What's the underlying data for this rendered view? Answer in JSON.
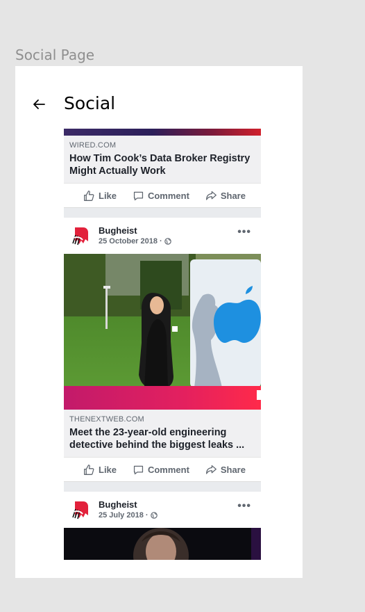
{
  "page_label": "Social Page",
  "header": {
    "title": "Social",
    "back_icon": "arrow-left-icon"
  },
  "posts": [
    {
      "link": {
        "domain": "WIRED.COM",
        "title": "How Tim Cook’s Data Broker Registry Might Actually Work"
      },
      "actions": {
        "like": "Like",
        "comment": "Comment",
        "share": "Share"
      }
    },
    {
      "author": "Bugheist",
      "date": "25 October 2018 ·",
      "link": {
        "domain": "THENEXTWEB.COM",
        "title": "Meet the 23-year-old engineering detective behind the biggest leaks ..."
      },
      "actions": {
        "like": "Like",
        "comment": "Comment",
        "share": "Share"
      }
    },
    {
      "author": "Bugheist",
      "date": "25 July 2018 ·"
    }
  ],
  "colors": {
    "accent_red": "#e2213b",
    "text_secondary": "#606770",
    "link_bg": "#f0f0f2"
  }
}
